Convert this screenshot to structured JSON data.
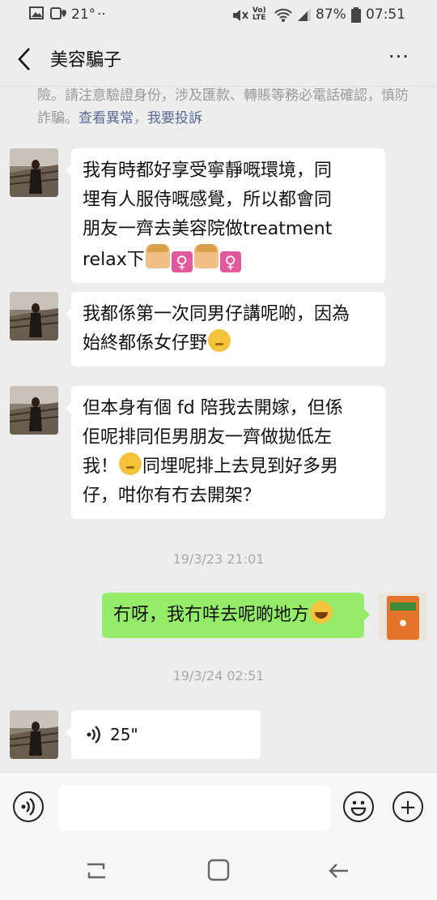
{
  "status_bar": {
    "temperature": "21°",
    "dots": "··",
    "lte_label": "VoLTE",
    "battery": "87%",
    "time": "07:51"
  },
  "header": {
    "title": "美容騙子",
    "more": "···"
  },
  "notice": {
    "text": "險。請注意驗證身份，涉及匯款、轉賬等務必電話確認，慎防詐騙。",
    "link1": "查看異常",
    "link2": "我要投訴"
  },
  "messages": [
    {
      "side": "left",
      "line1": " 我有時都好享受寧靜嘅環境，同",
      "line2": "埋有人服侍嘅感覺，所以都會同",
      "line3": "朋友一齊去美容院做treatment",
      "line4": "relax下"
    },
    {
      "side": "left",
      "line1": "我都係第一次同男仔講呢啲，因為",
      "line2": "始終都係女仔野"
    },
    {
      "side": "left",
      "line1": " 但本身有個 fd 陪我去開嫁，但係",
      "line2": "佢呢排同佢男朋友一齊做拋低左",
      "line3_a": "我！",
      "line3_b": "同埋呢排上去見到好多男",
      "line4": "仔，咁你有冇去開架？"
    },
    {
      "side": "right",
      "text": "冇呀，我冇咩去呢啲地方"
    },
    {
      "side": "left",
      "voice_duration": "25\""
    }
  ],
  "timestamps": [
    "19/3/23 21:01",
    "19/3/24 02:51"
  ],
  "icons": {
    "female_sign": "♀",
    "plus": "+"
  },
  "colors": {
    "bubble_right": "#95ec69",
    "bubble_left": "#ffffff",
    "link": "#576b95",
    "background": "#ededed"
  }
}
